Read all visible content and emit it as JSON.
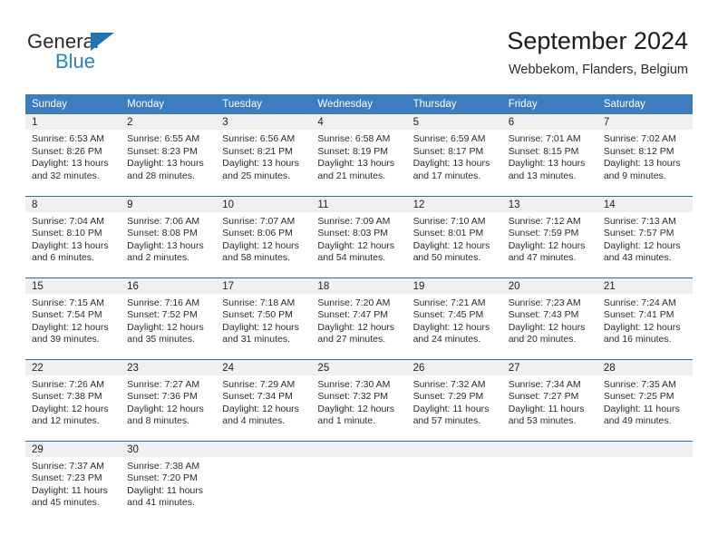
{
  "brand": {
    "name_top": "General",
    "name_bottom": "Blue",
    "accent_color": "#2484c6",
    "triangle_color": "#1f73b7"
  },
  "header": {
    "title": "September 2024",
    "subtitle": "Webbekom, Flanders, Belgium"
  },
  "calendar": {
    "header_bg": "#3c7cbf",
    "daynum_bg": "#f0f0f0",
    "row_border": "#2e6da4",
    "weekday_headers": [
      "Sunday",
      "Monday",
      "Tuesday",
      "Wednesday",
      "Thursday",
      "Friday",
      "Saturday"
    ],
    "weeks": [
      [
        {
          "day": "1",
          "sunrise": "Sunrise: 6:53 AM",
          "sunset": "Sunset: 8:26 PM",
          "daylight_line1": "Daylight: 13 hours",
          "daylight_line2": "and 32 minutes."
        },
        {
          "day": "2",
          "sunrise": "Sunrise: 6:55 AM",
          "sunset": "Sunset: 8:23 PM",
          "daylight_line1": "Daylight: 13 hours",
          "daylight_line2": "and 28 minutes."
        },
        {
          "day": "3",
          "sunrise": "Sunrise: 6:56 AM",
          "sunset": "Sunset: 8:21 PM",
          "daylight_line1": "Daylight: 13 hours",
          "daylight_line2": "and 25 minutes."
        },
        {
          "day": "4",
          "sunrise": "Sunrise: 6:58 AM",
          "sunset": "Sunset: 8:19 PM",
          "daylight_line1": "Daylight: 13 hours",
          "daylight_line2": "and 21 minutes."
        },
        {
          "day": "5",
          "sunrise": "Sunrise: 6:59 AM",
          "sunset": "Sunset: 8:17 PM",
          "daylight_line1": "Daylight: 13 hours",
          "daylight_line2": "and 17 minutes."
        },
        {
          "day": "6",
          "sunrise": "Sunrise: 7:01 AM",
          "sunset": "Sunset: 8:15 PM",
          "daylight_line1": "Daylight: 13 hours",
          "daylight_line2": "and 13 minutes."
        },
        {
          "day": "7",
          "sunrise": "Sunrise: 7:02 AM",
          "sunset": "Sunset: 8:12 PM",
          "daylight_line1": "Daylight: 13 hours",
          "daylight_line2": "and 9 minutes."
        }
      ],
      [
        {
          "day": "8",
          "sunrise": "Sunrise: 7:04 AM",
          "sunset": "Sunset: 8:10 PM",
          "daylight_line1": "Daylight: 13 hours",
          "daylight_line2": "and 6 minutes."
        },
        {
          "day": "9",
          "sunrise": "Sunrise: 7:06 AM",
          "sunset": "Sunset: 8:08 PM",
          "daylight_line1": "Daylight: 13 hours",
          "daylight_line2": "and 2 minutes."
        },
        {
          "day": "10",
          "sunrise": "Sunrise: 7:07 AM",
          "sunset": "Sunset: 8:06 PM",
          "daylight_line1": "Daylight: 12 hours",
          "daylight_line2": "and 58 minutes."
        },
        {
          "day": "11",
          "sunrise": "Sunrise: 7:09 AM",
          "sunset": "Sunset: 8:03 PM",
          "daylight_line1": "Daylight: 12 hours",
          "daylight_line2": "and 54 minutes."
        },
        {
          "day": "12",
          "sunrise": "Sunrise: 7:10 AM",
          "sunset": "Sunset: 8:01 PM",
          "daylight_line1": "Daylight: 12 hours",
          "daylight_line2": "and 50 minutes."
        },
        {
          "day": "13",
          "sunrise": "Sunrise: 7:12 AM",
          "sunset": "Sunset: 7:59 PM",
          "daylight_line1": "Daylight: 12 hours",
          "daylight_line2": "and 47 minutes."
        },
        {
          "day": "14",
          "sunrise": "Sunrise: 7:13 AM",
          "sunset": "Sunset: 7:57 PM",
          "daylight_line1": "Daylight: 12 hours",
          "daylight_line2": "and 43 minutes."
        }
      ],
      [
        {
          "day": "15",
          "sunrise": "Sunrise: 7:15 AM",
          "sunset": "Sunset: 7:54 PM",
          "daylight_line1": "Daylight: 12 hours",
          "daylight_line2": "and 39 minutes."
        },
        {
          "day": "16",
          "sunrise": "Sunrise: 7:16 AM",
          "sunset": "Sunset: 7:52 PM",
          "daylight_line1": "Daylight: 12 hours",
          "daylight_line2": "and 35 minutes."
        },
        {
          "day": "17",
          "sunrise": "Sunrise: 7:18 AM",
          "sunset": "Sunset: 7:50 PM",
          "daylight_line1": "Daylight: 12 hours",
          "daylight_line2": "and 31 minutes."
        },
        {
          "day": "18",
          "sunrise": "Sunrise: 7:20 AM",
          "sunset": "Sunset: 7:47 PM",
          "daylight_line1": "Daylight: 12 hours",
          "daylight_line2": "and 27 minutes."
        },
        {
          "day": "19",
          "sunrise": "Sunrise: 7:21 AM",
          "sunset": "Sunset: 7:45 PM",
          "daylight_line1": "Daylight: 12 hours",
          "daylight_line2": "and 24 minutes."
        },
        {
          "day": "20",
          "sunrise": "Sunrise: 7:23 AM",
          "sunset": "Sunset: 7:43 PM",
          "daylight_line1": "Daylight: 12 hours",
          "daylight_line2": "and 20 minutes."
        },
        {
          "day": "21",
          "sunrise": "Sunrise: 7:24 AM",
          "sunset": "Sunset: 7:41 PM",
          "daylight_line1": "Daylight: 12 hours",
          "daylight_line2": "and 16 minutes."
        }
      ],
      [
        {
          "day": "22",
          "sunrise": "Sunrise: 7:26 AM",
          "sunset": "Sunset: 7:38 PM",
          "daylight_line1": "Daylight: 12 hours",
          "daylight_line2": "and 12 minutes."
        },
        {
          "day": "23",
          "sunrise": "Sunrise: 7:27 AM",
          "sunset": "Sunset: 7:36 PM",
          "daylight_line1": "Daylight: 12 hours",
          "daylight_line2": "and 8 minutes."
        },
        {
          "day": "24",
          "sunrise": "Sunrise: 7:29 AM",
          "sunset": "Sunset: 7:34 PM",
          "daylight_line1": "Daylight: 12 hours",
          "daylight_line2": "and 4 minutes."
        },
        {
          "day": "25",
          "sunrise": "Sunrise: 7:30 AM",
          "sunset": "Sunset: 7:32 PM",
          "daylight_line1": "Daylight: 12 hours",
          "daylight_line2": "and 1 minute."
        },
        {
          "day": "26",
          "sunrise": "Sunrise: 7:32 AM",
          "sunset": "Sunset: 7:29 PM",
          "daylight_line1": "Daylight: 11 hours",
          "daylight_line2": "and 57 minutes."
        },
        {
          "day": "27",
          "sunrise": "Sunrise: 7:34 AM",
          "sunset": "Sunset: 7:27 PM",
          "daylight_line1": "Daylight: 11 hours",
          "daylight_line2": "and 53 minutes."
        },
        {
          "day": "28",
          "sunrise": "Sunrise: 7:35 AM",
          "sunset": "Sunset: 7:25 PM",
          "daylight_line1": "Daylight: 11 hours",
          "daylight_line2": "and 49 minutes."
        }
      ],
      [
        {
          "day": "29",
          "sunrise": "Sunrise: 7:37 AM",
          "sunset": "Sunset: 7:23 PM",
          "daylight_line1": "Daylight: 11 hours",
          "daylight_line2": "and 45 minutes."
        },
        {
          "day": "30",
          "sunrise": "Sunrise: 7:38 AM",
          "sunset": "Sunset: 7:20 PM",
          "daylight_line1": "Daylight: 11 hours",
          "daylight_line2": "and 41 minutes."
        },
        {
          "day": "",
          "sunrise": "",
          "sunset": "",
          "daylight_line1": "",
          "daylight_line2": ""
        },
        {
          "day": "",
          "sunrise": "",
          "sunset": "",
          "daylight_line1": "",
          "daylight_line2": ""
        },
        {
          "day": "",
          "sunrise": "",
          "sunset": "",
          "daylight_line1": "",
          "daylight_line2": ""
        },
        {
          "day": "",
          "sunrise": "",
          "sunset": "",
          "daylight_line1": "",
          "daylight_line2": ""
        },
        {
          "day": "",
          "sunrise": "",
          "sunset": "",
          "daylight_line1": "",
          "daylight_line2": ""
        }
      ]
    ]
  }
}
